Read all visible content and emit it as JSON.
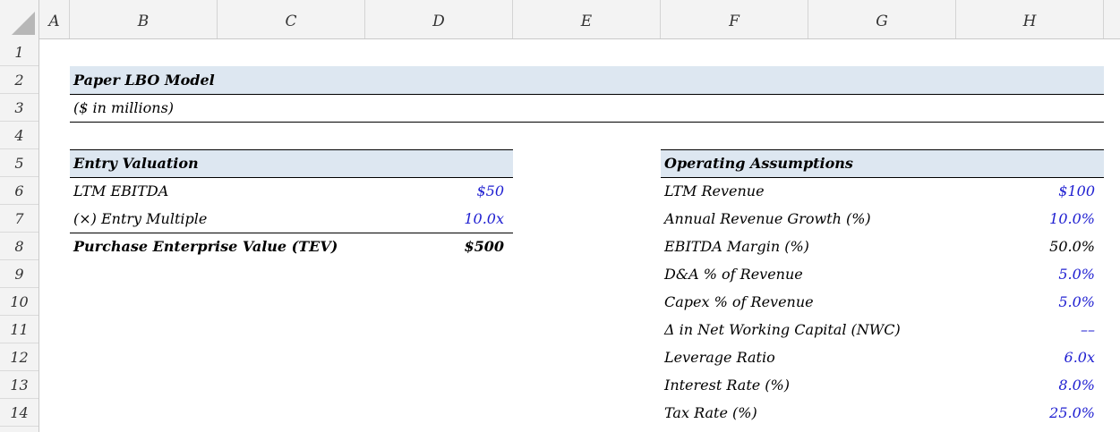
{
  "columns": [
    "A",
    "B",
    "C",
    "D",
    "E",
    "F",
    "G",
    "H"
  ],
  "rows": [
    "1",
    "2",
    "3",
    "4",
    "5",
    "6",
    "7",
    "8",
    "9",
    "10",
    "11",
    "12",
    "13",
    "14"
  ],
  "title": "Paper LBO Model",
  "subtitle": "($ in millions)",
  "entry_valuation": {
    "header": "Entry Valuation",
    "items": [
      {
        "label": "LTM EBITDA",
        "value": "$50"
      },
      {
        "label": "(×) Entry Multiple",
        "value": "10.0x"
      },
      {
        "label": "Purchase Enterprise Value (TEV)",
        "value": "$500"
      }
    ]
  },
  "operating_assumptions": {
    "header": "Operating Assumptions",
    "items": [
      {
        "label": "LTM Revenue",
        "value": "$100"
      },
      {
        "label": "Annual Revenue Growth (%)",
        "value": "10.0%"
      },
      {
        "label": "EBITDA Margin (%)",
        "value": "50.0%"
      },
      {
        "label": "D&A % of Revenue",
        "value": "5.0%"
      },
      {
        "label": "Capex % of Revenue",
        "value": "5.0%"
      },
      {
        "label": "Δ in Net Working Capital (NWC)",
        "value": "––"
      },
      {
        "label": "Leverage Ratio",
        "value": "6.0x"
      },
      {
        "label": "Interest Rate (%)",
        "value": "8.0%"
      },
      {
        "label": "Tax Rate (%)",
        "value": "25.0%"
      }
    ]
  },
  "colors": {
    "input_blue": "#1f1fd1",
    "header_band": "#dde7f1"
  }
}
